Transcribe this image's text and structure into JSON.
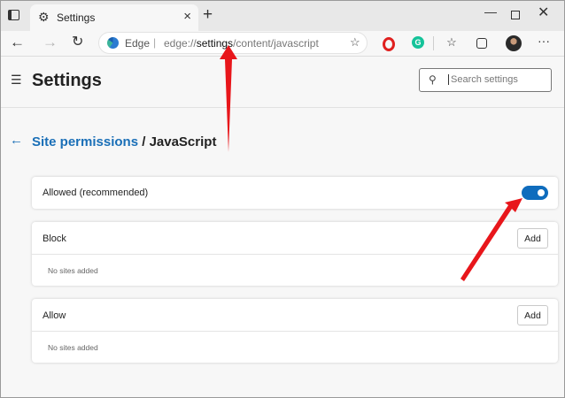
{
  "tab": {
    "title": "Settings"
  },
  "address": {
    "site_label": "Edge",
    "separator": "|",
    "url_prefix": "edge://",
    "url_strong": "settings",
    "url_suffix": "/content/javascript"
  },
  "header": {
    "title": "Settings",
    "search_placeholder": "Search settings"
  },
  "breadcrumb": {
    "parent": "Site permissions",
    "separator": " / ",
    "current": "JavaScript"
  },
  "sections": {
    "allowed": {
      "label": "Allowed (recommended)",
      "toggle_on": true
    },
    "block": {
      "label": "Block",
      "add_label": "Add",
      "empty_text": "No sites added"
    },
    "allow": {
      "label": "Allow",
      "add_label": "Add",
      "empty_text": "No sites added"
    }
  },
  "colors": {
    "accent": "#0f6cbd",
    "link": "#1a6fb7",
    "annotation_arrow": "#e8161b"
  },
  "icons": {
    "tab_actions": "tab-actions-icon",
    "settings_gear": "gear-icon",
    "close": "close-icon",
    "new_tab": "plus-icon",
    "back": "back-arrow-icon",
    "forward": "forward-arrow-icon",
    "reload": "reload-icon",
    "favorite": "star-plus-icon",
    "search": "search-icon",
    "menu": "hamburger-icon"
  }
}
